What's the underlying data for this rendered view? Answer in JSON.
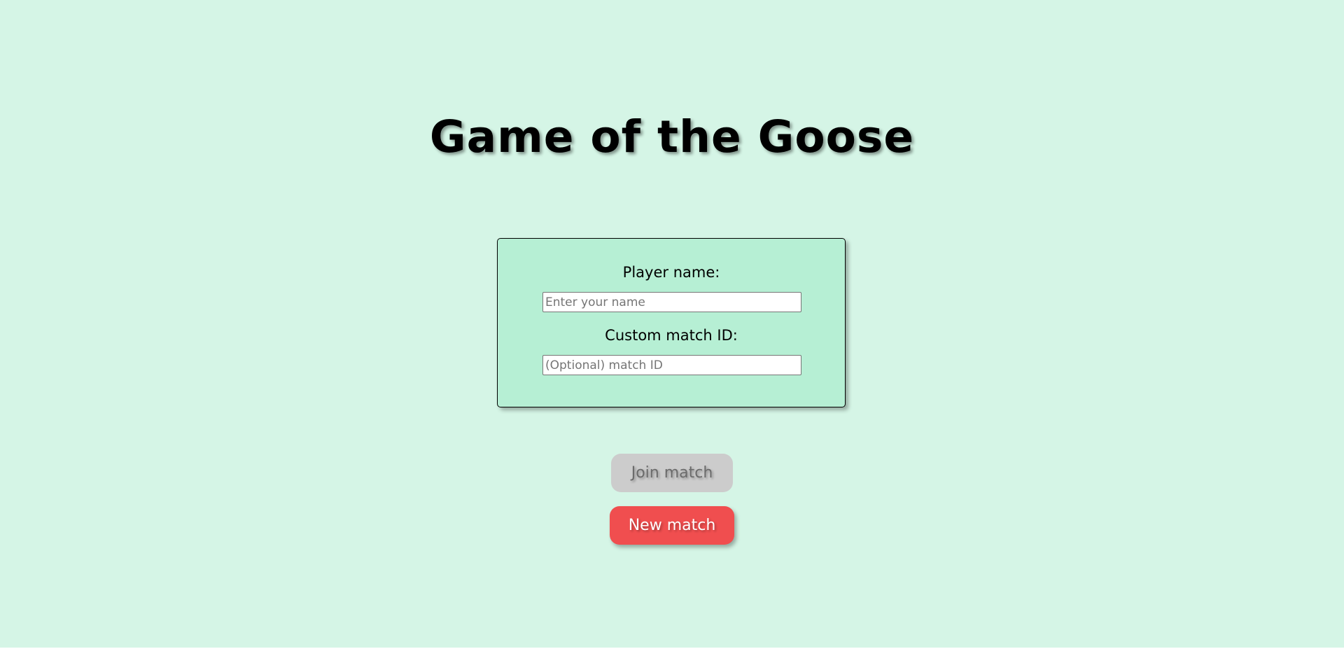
{
  "header": {
    "title": "Game of the Goose"
  },
  "form": {
    "player_name_label": "Player name:",
    "player_name_placeholder": "Enter your name",
    "player_name_value": "",
    "match_id_label": "Custom match ID:",
    "match_id_placeholder": "(Optional) match ID",
    "match_id_value": ""
  },
  "actions": {
    "join_label": "Join match",
    "join_enabled": false,
    "new_label": "New match"
  },
  "colors": {
    "background": "#d5f5e6",
    "card": "#b6efd4",
    "join_disabled": "#cccccc",
    "new_match": "#f04e4f"
  }
}
